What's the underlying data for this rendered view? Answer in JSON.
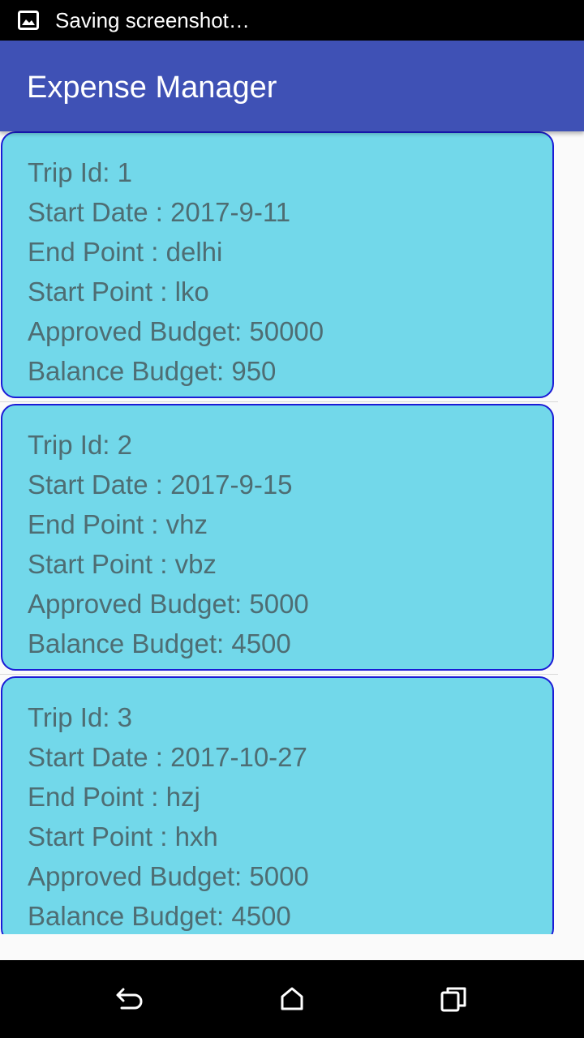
{
  "status_bar": {
    "notification_icon": "image-icon",
    "text": "Saving screenshot…"
  },
  "app_bar": {
    "title": "Expense Manager",
    "color": "#3f51b5"
  },
  "card_color": "#72d8ea",
  "card_border_color": "#1b1bd6",
  "trips": [
    {
      "trip_id": "Trip Id: 1",
      "start_date": "Start Date : 2017-9-11",
      "end_point": "End Point : delhi",
      "start_point": "Start Point : lko",
      "approved_budget": "Approved Budget: 50000",
      "balance_budget": "Balance Budget: 950"
    },
    {
      "trip_id": "Trip Id: 2",
      "start_date": "Start Date : 2017-9-15",
      "end_point": "End Point : vhz",
      "start_point": "Start Point : vbz",
      "approved_budget": "Approved Budget: 5000",
      "balance_budget": "Balance Budget: 4500"
    },
    {
      "trip_id": "Trip Id: 3",
      "start_date": "Start Date : 2017-10-27",
      "end_point": "End Point : hzj",
      "start_point": "Start Point : hxh",
      "approved_budget": "Approved Budget: 5000",
      "balance_budget": "Balance Budget: 4500"
    }
  ],
  "nav_bar": {
    "back_icon": "back-icon",
    "home_icon": "home-icon",
    "recent_icon": "recent-apps-icon"
  }
}
